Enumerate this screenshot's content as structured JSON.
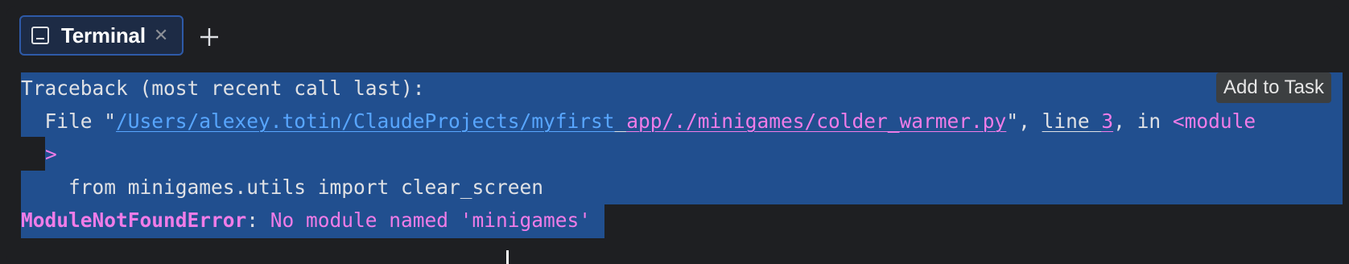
{
  "tabs": [
    {
      "label": "Terminal",
      "icon": "terminal-icon",
      "close_icon": "close-icon"
    }
  ],
  "new_tab_icon": "plus-icon",
  "add_to_task_label": "Add to Task",
  "output": {
    "traceback_header": "Traceback (most recent call last):",
    "file_prefix": "  File \"",
    "file_path_blue": "/Users/alexey.totin/ClaudeProjects/myfirst",
    "file_path_space": " ",
    "file_path_pink": "app/./minigames/colder_warmer.py",
    "file_suffix_1": "\", ",
    "line_word": "line",
    "line_space": " ",
    "line_number": "3",
    "in_text": ", in ",
    "module_text": "<module",
    "module_wrap": ">",
    "source_line": "    from minigames.utils import clear_screen",
    "error_name": "ModuleNotFoundError",
    "error_colon": ": ",
    "error_message": "No module named 'minigames'"
  },
  "colors": {
    "background": "#1e1f22",
    "selection": "#214f8f",
    "link": "#58a6ff",
    "error_pink": "#f07ce8",
    "tab_border": "#2e5aa8"
  }
}
